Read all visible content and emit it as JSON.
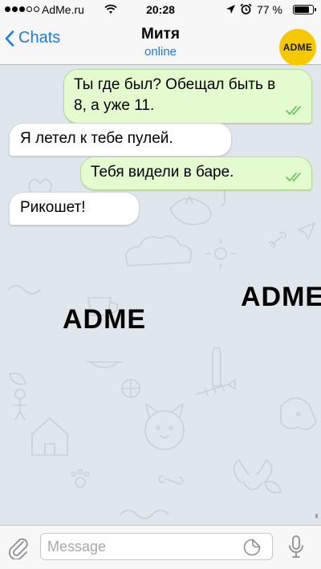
{
  "status_bar": {
    "carrier": "AdMe.ru",
    "time": "20:28",
    "battery": "77 %"
  },
  "header": {
    "back_label": "Chats",
    "contact_name": "Митя",
    "contact_status": "online",
    "avatar_text": "ADME",
    "accent_color": "#1f7ae0",
    "avatar_color": "#f5c800"
  },
  "chat": {
    "wallpaper_color": "#dfe6ec",
    "watermark": "ADME",
    "messages": [
      {
        "direction": "outgoing",
        "text": "Ты где был? Обещал быть в 8, а уже 11.",
        "status_icon": "double-check-icon"
      },
      {
        "direction": "incoming",
        "text": "Я летел к тебе пулей."
      },
      {
        "direction": "outgoing",
        "text": "Тебя видели в баре.",
        "status_icon": "double-check-icon"
      },
      {
        "direction": "incoming",
        "text": "Рикошет!"
      }
    ]
  },
  "input_bar": {
    "placeholder": "Message"
  },
  "colors": {
    "outgoing_bubble": "#e4fbcf",
    "incoming_bubble": "#ffffff",
    "read_check": "#5dc452"
  }
}
